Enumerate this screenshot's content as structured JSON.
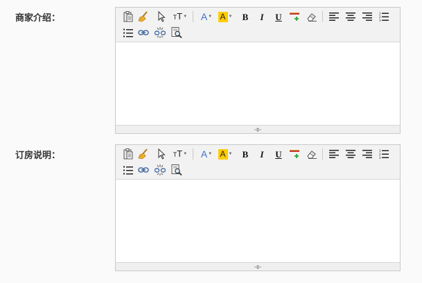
{
  "fields": [
    {
      "label": "商家介绍：",
      "content": ""
    },
    {
      "label": "订房说明：",
      "content": ""
    }
  ],
  "toolbar": {
    "font_size_glyph": "TT",
    "font_color_glyph": "A",
    "highlight_glyph": "A",
    "bold_glyph": "B",
    "italic_glyph": "I",
    "underline_glyph": "U"
  },
  "colors": {
    "font_color": "#3d72c9",
    "highlight": "#ffcc00",
    "border": "#c9c9c9",
    "toolbar_bg": "#f2f2f2"
  }
}
